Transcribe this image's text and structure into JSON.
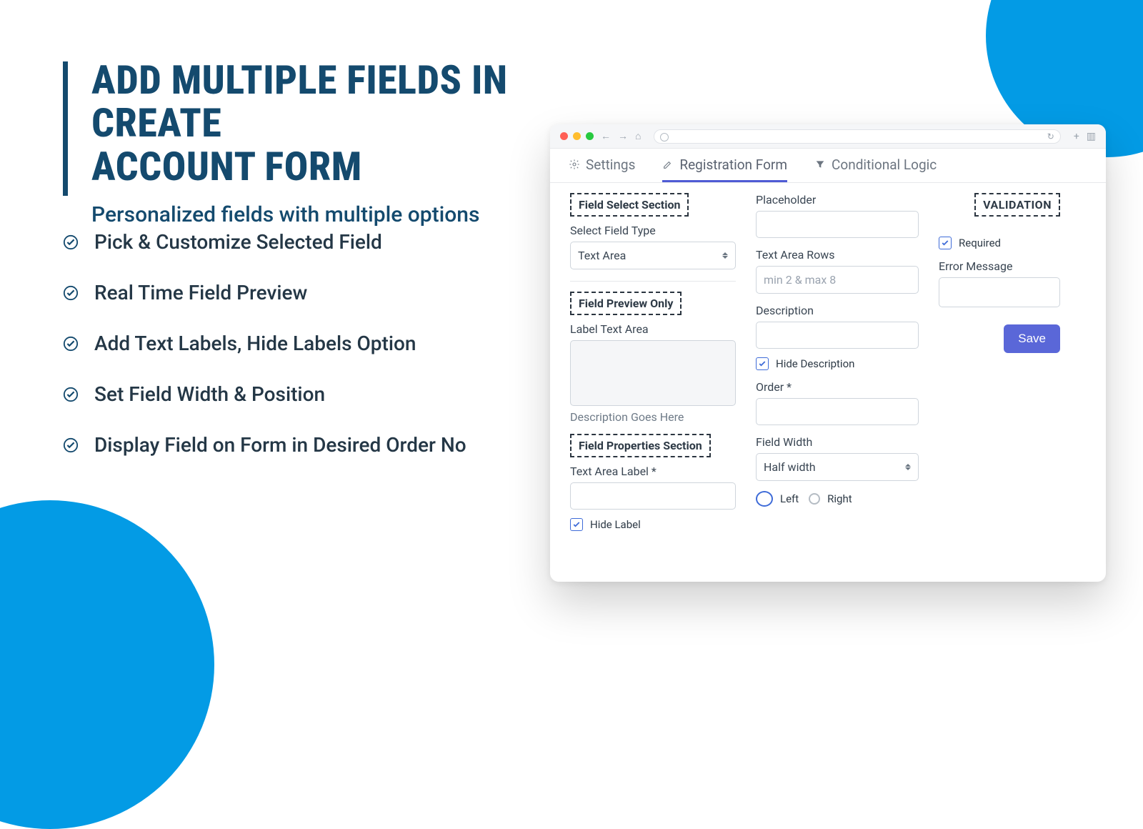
{
  "hero": {
    "title_line1": "ADD MULTIPLE FIELDS IN CREATE",
    "title_line2": "ACCOUNT FORM",
    "subtitle": "Personalized fields with multiple options"
  },
  "features": [
    "Pick & Customize Selected Field",
    "Real Time Field Preview",
    "Add Text Labels, Hide Labels Option",
    "Set Field Width & Position",
    "Display Field on Form in Desired Order No"
  ],
  "window": {
    "tabs": {
      "settings": "Settings",
      "registration": "Registration Form",
      "conditional": "Conditional Logic"
    },
    "col1": {
      "section_select_title": "Field Select Section",
      "select_field_type_label": "Select Field Type",
      "select_field_type_value": "Text Area",
      "section_preview_title": "Field Preview Only",
      "label_text_area_label": "Label Text Area",
      "desc_placeholder": "Description Goes Here",
      "section_props_title": "Field Properties Section",
      "text_area_label_label": "Text Area Label *",
      "hide_label_label": "Hide Label"
    },
    "col2": {
      "placeholder_label": "Placeholder",
      "text_area_rows_label": "Text Area Rows",
      "text_area_rows_ph": "min 2 & max 8",
      "description_label": "Description",
      "hide_description_label": "Hide Description",
      "order_label": "Order *",
      "field_width_label": "Field Width",
      "field_width_value": "Half width",
      "align_left": "Left",
      "align_right": "Right"
    },
    "col3": {
      "validation_title": "VALIDATION",
      "required_label": "Required",
      "error_message_label": "Error Message",
      "save_label": "Save"
    }
  }
}
